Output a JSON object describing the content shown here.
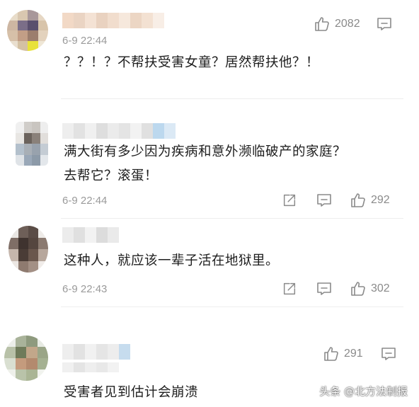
{
  "comments": [
    {
      "time": "6-9 22:44",
      "text_lines": [
        "？？！？不帮扶受害女童？居然帮扶他？！"
      ],
      "likes": "2082",
      "actions": [
        "like-icon",
        "comment-icon"
      ]
    },
    {
      "time": "6-9 22:44",
      "text_lines": [
        "满大街有多少因为疾病和意外濒临破产的家庭？",
        "去帮它？滚蛋！"
      ],
      "likes": "292",
      "actions": [
        "share-icon",
        "comment-icon",
        "like-icon"
      ]
    },
    {
      "time": "6-9 22:43",
      "text_lines": [
        "这种人，就应该一辈子活在地狱里。"
      ],
      "likes": "302",
      "actions": [
        "share-icon",
        "comment-icon",
        "like-icon"
      ]
    },
    {
      "time": "",
      "text_lines": [
        "受害者见到估计会崩溃"
      ],
      "likes": "291",
      "actions": [
        "like-icon",
        "comment-icon"
      ]
    }
  ],
  "watermark": "头条 @北方法制报",
  "colors": {
    "text": "#1e1e1e",
    "meta": "#9a9a9a",
    "icon": "#8a8a8a"
  }
}
